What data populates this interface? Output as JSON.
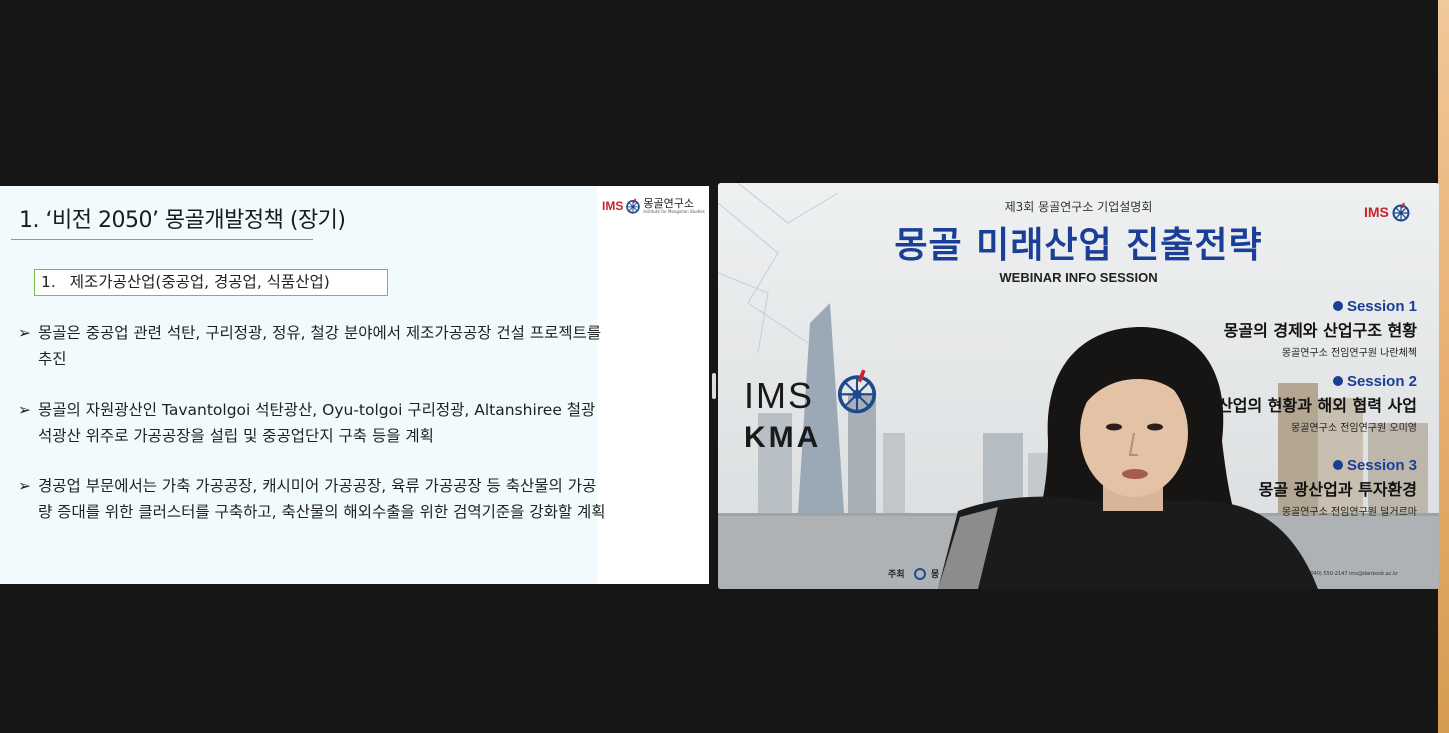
{
  "slide": {
    "title": "1. ‘비전 2050’ 몽골개발정책 (장기)",
    "logo_ims": "IMS",
    "logo_name": "몽골연구소",
    "logo_sub": "Institute for Mongolian Studies",
    "section_number": "1.",
    "section_label": "제조가공산업(중공업, 경공업, 식품산업)",
    "bullet_mark": "➢",
    "bullets": [
      "몽골은 중공업 관련 석탄, 구리정광, 정유, 철강 분야에서 제조가공공장 건설 프로젝트를 추진",
      "몽골의 자원광산인 Tavantolgoi 석탄광산, Oyu-tolgoi 구리정광, Altanshiree 철광석광산 위주로 가공공장을 설립 및 중공업단지 구축 등을 계획",
      "경공업 부문에서는 가축 가공공장, 캐시미어 가공공장, 육류 가공공장 등 축산물의 가공량 증대를 위한 클러스터를 구축하고, 축산물의 해외수출을 위한 검역기준을 강화할 계획"
    ]
  },
  "video": {
    "top_caption": "제3회 몽골연구소 기업설명회",
    "title": "몽골 미래산업 진출전략",
    "subtitle": "WEBINAR INFO SESSION",
    "top_logo": "IMS",
    "big_logo_ims": "IMS",
    "big_logo_kma": "KMA",
    "sessions": [
      {
        "label": "Session 1",
        "title": "몽골의 경제와 산업구조 현황",
        "presenter": "몽골연구소 전임연구원 나란체첵"
      },
      {
        "label": "Session 2",
        "title": "골 농축산업의 현황과 해외 협력 사업",
        "presenter": "몽골연구소 전임연구원 오미영"
      },
      {
        "label": "Session 3",
        "title": "몽골 광산업과 투자환경",
        "presenter": "몽골연구소 전임연구원 덜거르마"
      }
    ],
    "footer_host": "주최",
    "footer_logo_text": "몽",
    "footer_contact": "| 문의 : 040) 550-2147  ims@dankook.ac.kr"
  },
  "colors": {
    "slide_bg": "#f1fbfd",
    "brand_red": "#c8242e",
    "title_blue": "#1b3e96",
    "section_border": "#7cbc4a"
  },
  "icons": [
    "ims-wheel-icon",
    "globe-icon",
    "pane-resize-handle"
  ]
}
